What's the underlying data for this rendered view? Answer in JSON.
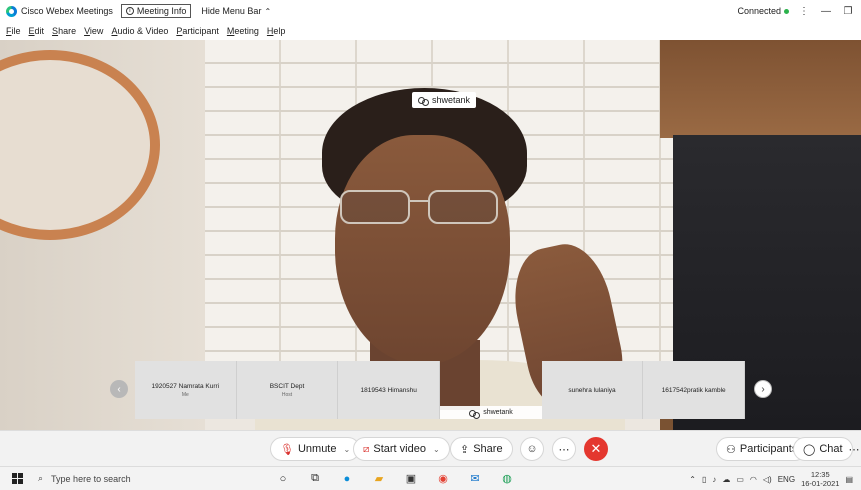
{
  "titlebar": {
    "app_title": "Cisco Webex Meetings",
    "meeting_info_label": "Meeting Info",
    "hide_menu_label": "Hide Menu Bar",
    "status": "Connected"
  },
  "menu": [
    "File",
    "Edit",
    "Share",
    "View",
    "Audio & Video",
    "Participant",
    "Meeting",
    "Help"
  ],
  "active_speaker": "shwetank",
  "filmstrip": [
    {
      "name": "1920527 Namrata Kurri",
      "sub": "Me"
    },
    {
      "name": "BSCIT Dept",
      "sub": "Host"
    },
    {
      "name": "1819543 Himanshu",
      "sub": ""
    },
    {
      "name": "shwetank",
      "sub": ""
    },
    {
      "name": "sunehra lulaniya",
      "sub": ""
    },
    {
      "name": "1617542pratik kamble",
      "sub": ""
    }
  ],
  "controls": {
    "unmute": "Unmute",
    "start_video": "Start video",
    "share": "Share",
    "participants": "Participants",
    "chat": "Chat"
  },
  "taskbar": {
    "search_placeholder": "Type here to search",
    "language": "ENG",
    "time": "12:35",
    "date": "16-01-2021"
  }
}
